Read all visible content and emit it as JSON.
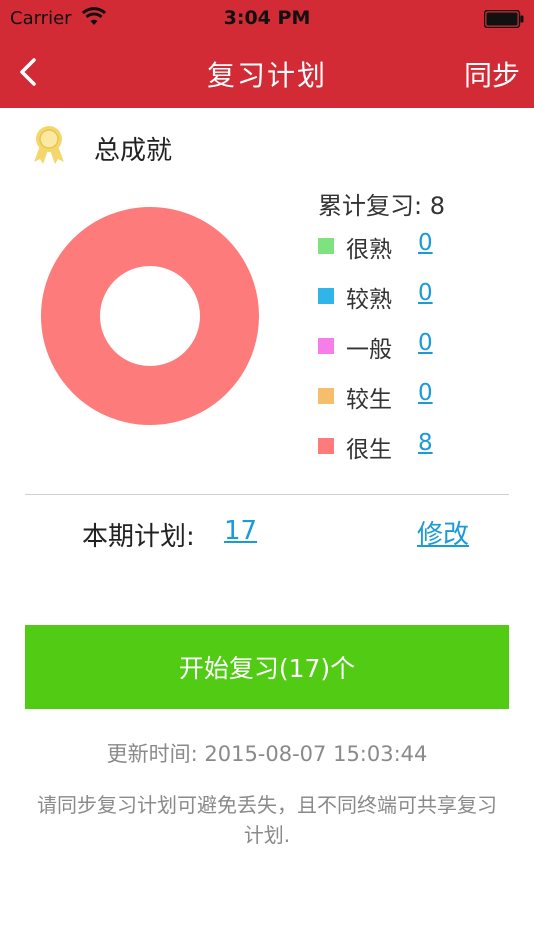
{
  "status_bar": {
    "carrier": "Carrier",
    "time": "3:04 PM"
  },
  "nav": {
    "title": "复习计划",
    "sync_label": "同步"
  },
  "achievement": {
    "title": "总成就",
    "total_label": "累计复习: 8",
    "donut_values": [
      0,
      0,
      0,
      0,
      8
    ],
    "legend": [
      {
        "label": "很熟",
        "value": "0",
        "color": "#7ee27e"
      },
      {
        "label": "较熟",
        "value": "0",
        "color": "#2fb5e8"
      },
      {
        "label": "一般",
        "value": "0",
        "color": "#f77de8"
      },
      {
        "label": "较生",
        "value": "0",
        "color": "#f5bd6c"
      },
      {
        "label": "很生",
        "value": "8",
        "color": "#fd7b7b"
      }
    ]
  },
  "plan": {
    "label": "本期计划:",
    "value": "17",
    "modify_label": "修改"
  },
  "start_button": "开始复习(17)个",
  "updated": {
    "label": "更新时间:",
    "value": "2015-08-07 15:03:44"
  },
  "tip": "请同步复习计划可避免丢失，且不同终端可共享复习计划.",
  "colors": {
    "header": "#d32b35",
    "primary_button": "#52cb14",
    "link": "#1a9ad6"
  }
}
